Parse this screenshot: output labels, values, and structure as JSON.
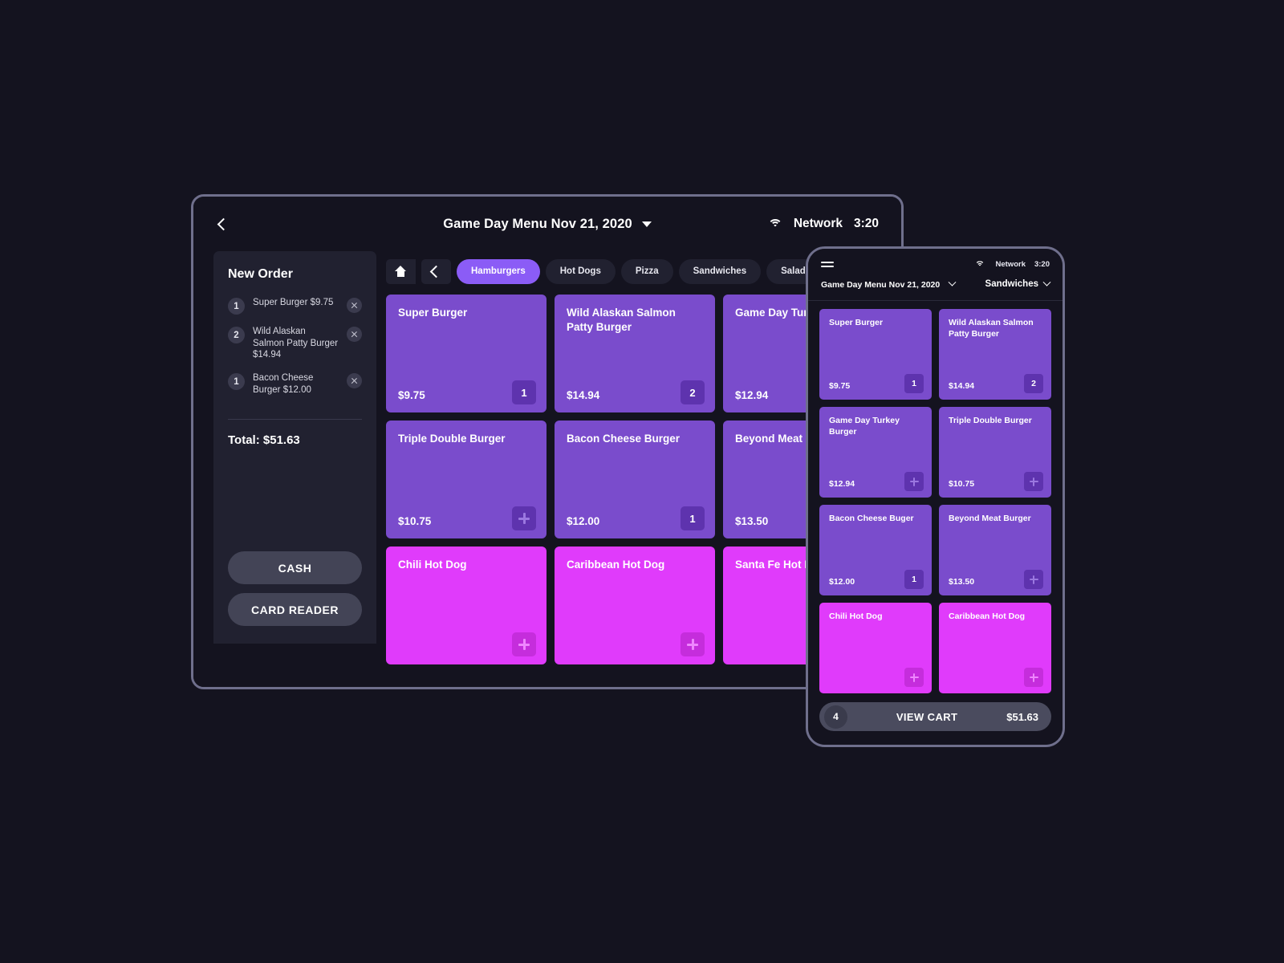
{
  "tablet": {
    "header": {
      "back_icon": "chevron-left-icon",
      "title": "Game Day Menu Nov 21, 2020",
      "dropdown_icon": "caret-down-icon",
      "wifi_icon": "wifi-icon",
      "network_label": "Network",
      "time": "3:20"
    },
    "sidebar": {
      "title": "New Order",
      "items": [
        {
          "qty": "1",
          "text": "Super Burger $9.75",
          "remove_icon": "close-icon"
        },
        {
          "qty": "2",
          "text": "Wild Alaskan Salmon Patty Burger $14.94",
          "remove_icon": "close-icon"
        },
        {
          "qty": "1",
          "text": "Bacon Cheese Burger $12.00",
          "remove_icon": "close-icon"
        }
      ],
      "total_label": "Total: $51.63",
      "cash_label": "CASH",
      "card_reader_label": "CARD READER"
    },
    "categories": {
      "home_icon": "home-icon",
      "back_icon": "chevron-left-icon",
      "tabs": [
        {
          "label": "Hamburgers",
          "active": true
        },
        {
          "label": "Hot Dogs",
          "active": false
        },
        {
          "label": "Pizza",
          "active": false
        },
        {
          "label": "Sandwiches",
          "active": false
        },
        {
          "label": "Salads",
          "active": false
        }
      ]
    },
    "products": [
      {
        "name": "Super Burger",
        "price": "$9.75",
        "qty": "1",
        "color": "purple"
      },
      {
        "name": "Wild Alaskan Salmon Patty Burger",
        "price": "$14.94",
        "qty": "2",
        "color": "purple"
      },
      {
        "name": "Game Day Turkey Burger",
        "price": "$12.94",
        "qty": null,
        "color": "purple"
      },
      {
        "name": "Triple Double Burger",
        "price": "$10.75",
        "qty": null,
        "color": "purple"
      },
      {
        "name": "Bacon Cheese Burger",
        "price": "$12.00",
        "qty": "1",
        "color": "purple"
      },
      {
        "name": "Beyond Meat Burger",
        "price": "$13.50",
        "qty": null,
        "color": "purple"
      },
      {
        "name": "Chili Hot Dog",
        "price": "",
        "qty": null,
        "color": "magenta"
      },
      {
        "name": "Caribbean Hot Dog",
        "price": "",
        "qty": null,
        "color": "magenta"
      },
      {
        "name": "Santa Fe Hot Dog",
        "price": "",
        "qty": null,
        "color": "magenta"
      }
    ]
  },
  "phone": {
    "status": {
      "menu_icon": "hamburger-menu-icon",
      "wifi_icon": "wifi-icon",
      "network_label": "Network",
      "time": "3:20"
    },
    "menubar": {
      "menu_title": "Game Day Menu Nov 21, 2020",
      "menu_caret": "chevron-down-icon",
      "category_title": "Sandwiches",
      "category_caret": "chevron-down-icon"
    },
    "products": [
      {
        "name": "Super Burger",
        "price": "$9.75",
        "qty": "1",
        "color": "purple"
      },
      {
        "name": "Wild Alaskan Salmon Patty Burger",
        "price": "$14.94",
        "qty": "2",
        "color": "purple"
      },
      {
        "name": "Game Day Turkey Burger",
        "price": "$12.94",
        "qty": null,
        "color": "purple"
      },
      {
        "name": "Triple Double Burger",
        "price": "$10.75",
        "qty": null,
        "color": "purple"
      },
      {
        "name": "Bacon Cheese Buger",
        "price": "$12.00",
        "qty": "1",
        "color": "purple"
      },
      {
        "name": "Beyond Meat Burger",
        "price": "$13.50",
        "qty": null,
        "color": "purple"
      },
      {
        "name": "Chili Hot Dog",
        "price": "",
        "qty": null,
        "color": "magenta"
      },
      {
        "name": "Caribbean Hot Dog",
        "price": "",
        "qty": null,
        "color": "magenta"
      }
    ],
    "cart": {
      "count": "4",
      "label": "VIEW CART",
      "total": "$51.63"
    }
  },
  "colors": {
    "background": "#14131f",
    "frame_border": "#6f6f8c",
    "panel": "#212130",
    "accent_purple": "#8b5cf6",
    "card_purple": "#7a4ccc",
    "card_magenta": "#e03bfb",
    "button_gray": "#434456"
  }
}
